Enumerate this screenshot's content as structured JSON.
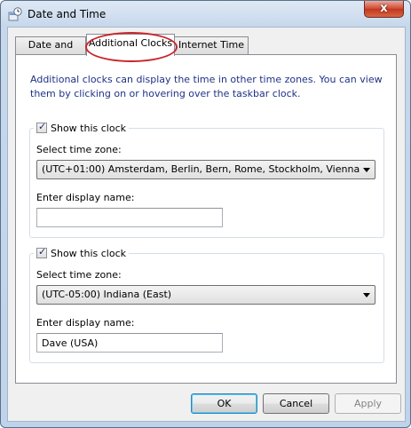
{
  "window": {
    "title": "Date and Time",
    "close_glyph": "x"
  },
  "tabs": [
    {
      "label": "Date and Time"
    },
    {
      "label": "Additional Clocks"
    },
    {
      "label": "Internet Time"
    }
  ],
  "active_tab": "Additional Clocks",
  "description": "Additional clocks can display the time in other time zones. You can view them by clicking on or hovering over the taskbar clock.",
  "clocks": [
    {
      "show_label": "Show this clock",
      "checked": true,
      "timezone_label": "Select time zone:",
      "timezone_value": "(UTC+01:00) Amsterdam, Berlin, Bern, Rome, Stockholm, Vienna",
      "name_label": "Enter display name:",
      "name_value": ""
    },
    {
      "show_label": "Show this clock",
      "checked": true,
      "timezone_label": "Select time zone:",
      "timezone_value": "(UTC-05:00) Indiana (East)",
      "name_label": "Enter display name:",
      "name_value": "Dave (USA)"
    }
  ],
  "buttons": {
    "ok": "OK",
    "cancel": "Cancel",
    "apply": "Apply"
  },
  "colors": {
    "description_text": "#1e3287",
    "highlight_ellipse": "#c8262b"
  },
  "icons": {
    "window": "clock-icon",
    "close": "close-icon",
    "dropdown": "chevron-down-icon",
    "checkbox": "checkmark-icon"
  }
}
